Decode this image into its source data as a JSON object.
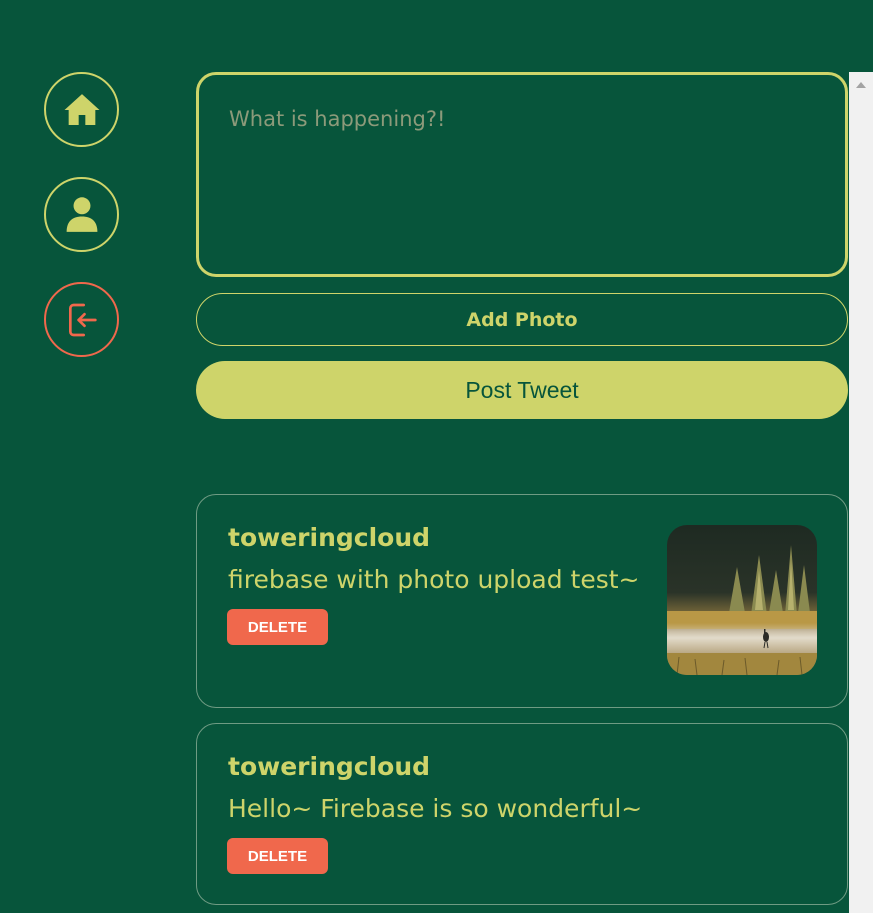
{
  "sidebar": {
    "items": [
      {
        "name": "home",
        "icon": "home-icon"
      },
      {
        "name": "profile",
        "icon": "user-icon"
      },
      {
        "name": "logout",
        "icon": "logout-icon"
      }
    ]
  },
  "composer": {
    "placeholder": "What is happening?!",
    "value": ""
  },
  "buttons": {
    "add_photo": "Add Photo",
    "post_tweet": "Post Tweet"
  },
  "tweets": [
    {
      "username": "toweringcloud",
      "text": "firebase with photo upload test~",
      "delete_label": "DELETE",
      "has_photo": true
    },
    {
      "username": "toweringcloud",
      "text": "Hello~ Firebase is so wonderful~",
      "delete_label": "DELETE",
      "has_photo": false
    }
  ],
  "colors": {
    "background": "#07553b",
    "accent": "#ced46a",
    "danger": "#f0684c"
  }
}
